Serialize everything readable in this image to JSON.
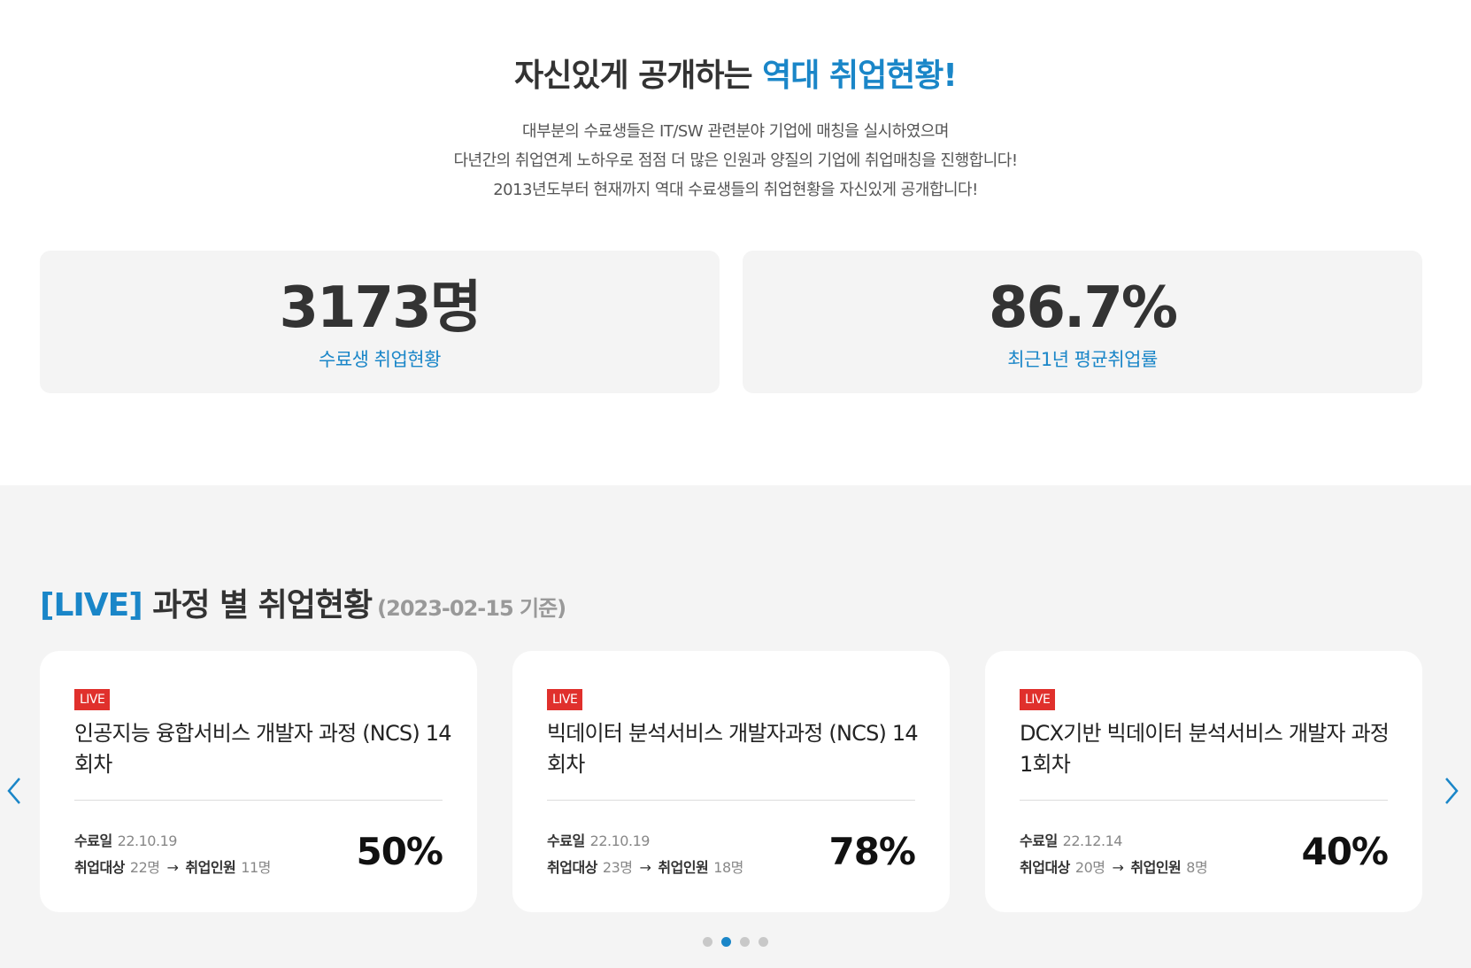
{
  "header": {
    "title_main": "자신있게 공개하는 ",
    "title_accent": "역대 취업현황!",
    "desc_lines": [
      "대부분의 수료생들은 IT/SW 관련분야 기업에 매칭을 실시하였으며",
      "다년간의 취업연계 노하우로 점점 더 많은 인원과 양질의 기업에 취업매칭을 진행합니다!",
      "2013년도부터 현재까지 역대 수료생들의 취업현황을 자신있게 공개합니다!"
    ]
  },
  "stats": [
    {
      "value": "3173명",
      "label": "수료생 취업현황"
    },
    {
      "value": "86.7%",
      "label": "최근1년 평균취업률"
    }
  ],
  "live_section": {
    "tag": "[LIVE]",
    "title": " 과정 별 취업현황",
    "date": "(2023-02-15 기준)"
  },
  "courses": [
    {
      "badge": "LIVE",
      "title": "인공지능 융합서비스 개발자 과정 (NCS) 14회차",
      "end_label": "수료일",
      "end_date": "22.10.19",
      "target_label": "취업대상",
      "target_count": "22명",
      "arrow": "→",
      "employed_label": "취업인원",
      "employed_count": "11명",
      "rate": "50%"
    },
    {
      "badge": "LIVE",
      "title": "빅데이터 분석서비스 개발자과정 (NCS) 14회차",
      "end_label": "수료일",
      "end_date": "22.10.19",
      "target_label": "취업대상",
      "target_count": "23명",
      "arrow": "→",
      "employed_label": "취업인원",
      "employed_count": "18명",
      "rate": "78%"
    },
    {
      "badge": "LIVE",
      "title": "DCX기반 빅데이터 분석서비스 개발자 과정 1회차",
      "end_label": "수료일",
      "end_date": "22.12.14",
      "target_label": "취업대상",
      "target_count": "20명",
      "arrow": "→",
      "employed_label": "취업인원",
      "employed_count": "8명",
      "rate": "40%"
    }
  ],
  "carousel": {
    "prev_icon": "chevron-left-icon",
    "next_icon": "chevron-right-icon",
    "dot_count": 4,
    "active_dot": 1,
    "accent_color": "#1a86c8",
    "live_badge_color": "#e0302c"
  }
}
